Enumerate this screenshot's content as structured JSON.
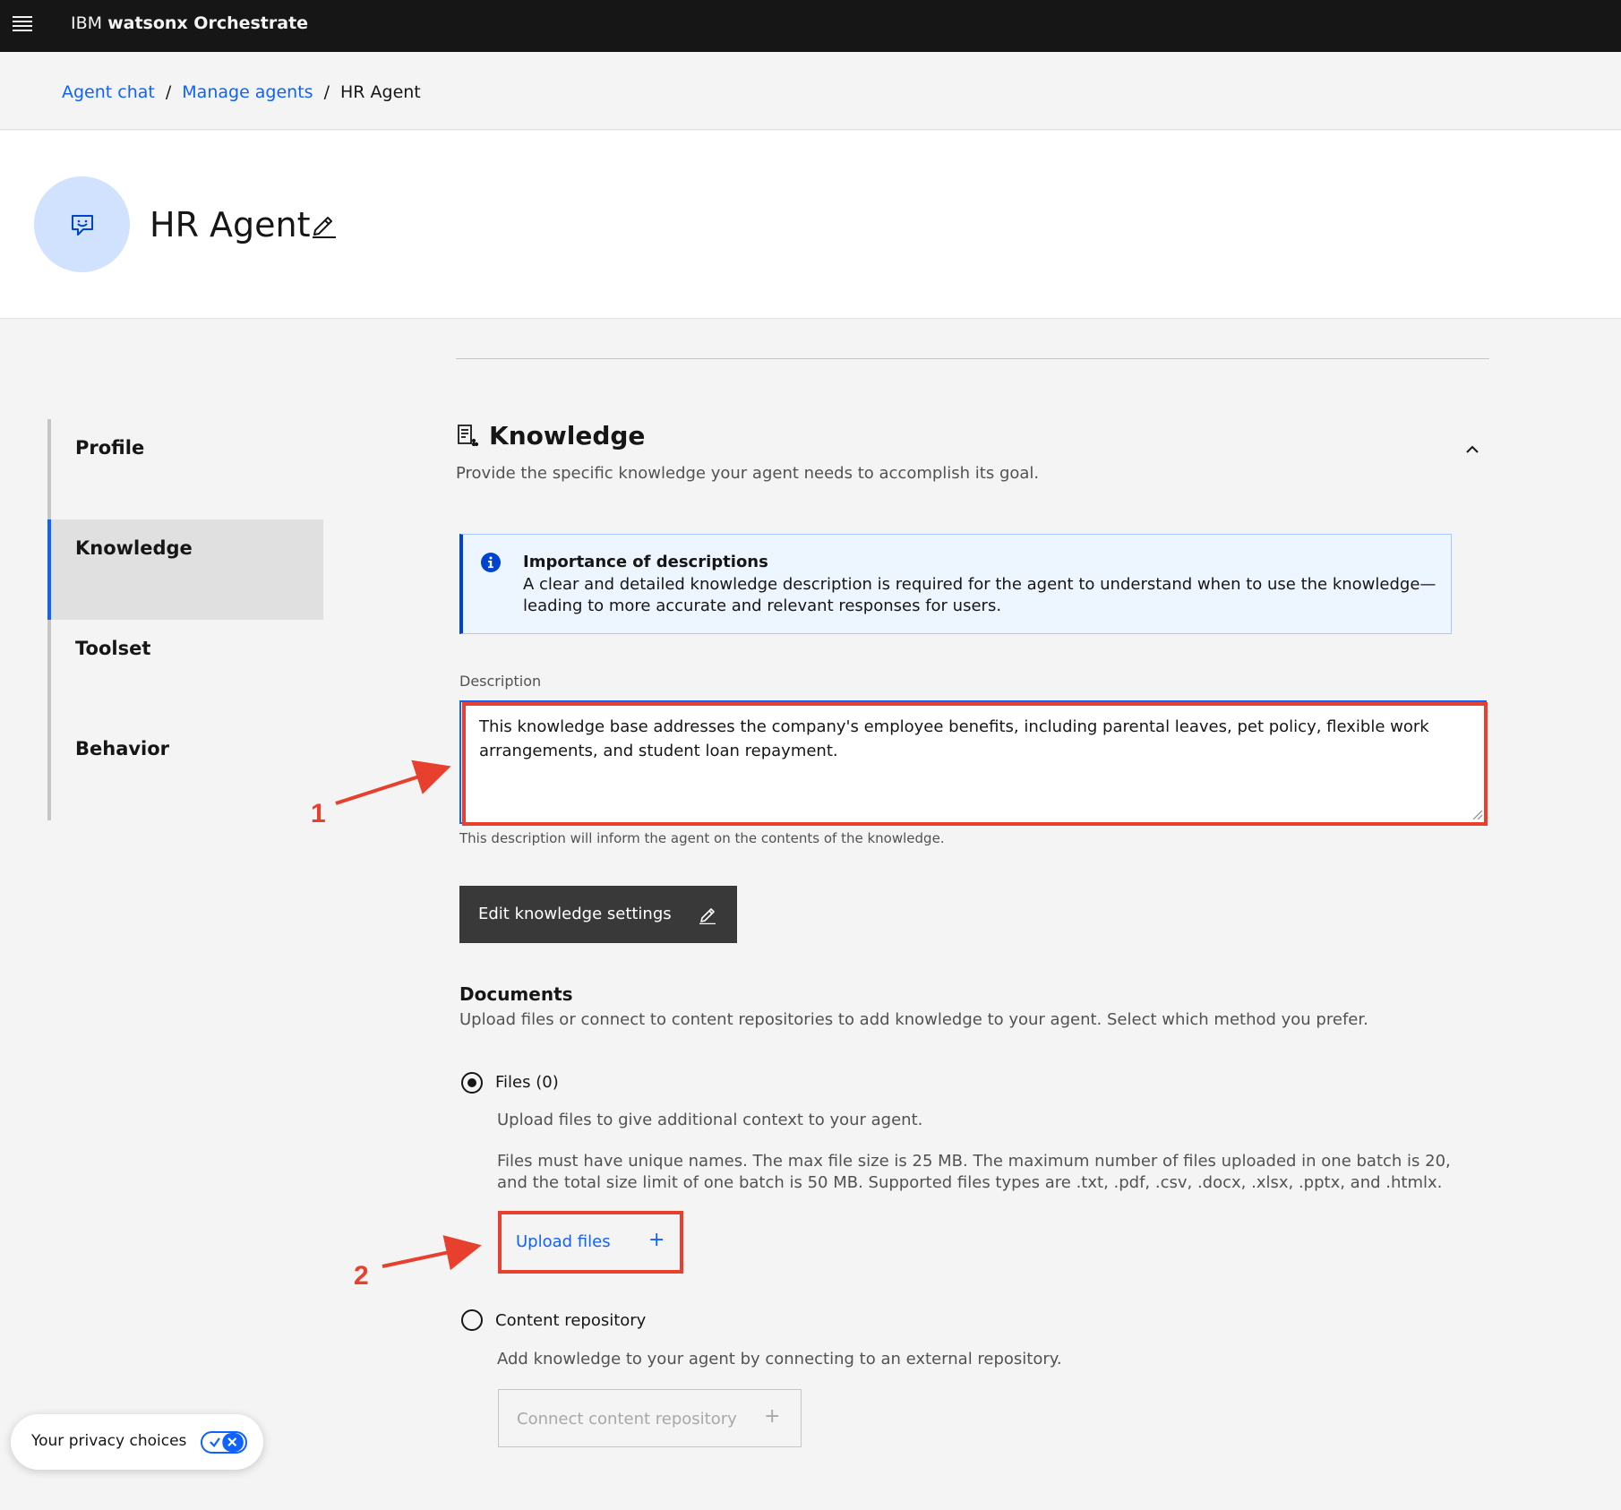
{
  "topbar": {
    "brand_prefix": "IBM ",
    "brand_name": "watsonx Orchestrate"
  },
  "breadcrumb": {
    "items": [
      {
        "label": "Agent chat"
      },
      {
        "label": "Manage agents"
      },
      {
        "label": "HR Agent"
      }
    ],
    "separator": "/"
  },
  "header": {
    "title": "HR Agent"
  },
  "sidenav": {
    "items": [
      {
        "label": "Profile"
      },
      {
        "label": "Knowledge"
      },
      {
        "label": "Toolset"
      },
      {
        "label": "Behavior"
      }
    ],
    "active": "Knowledge"
  },
  "knowledge": {
    "title": "Knowledge",
    "description": "Provide the specific knowledge your agent needs to accomplish its goal.",
    "notification": {
      "title": "Importance of descriptions",
      "body": "A clear and detailed knowledge description is required for the agent to understand when to use the knowledge—leading to more accurate and relevant responses for users."
    },
    "description_field": {
      "label": "Description",
      "value": "This knowledge base addresses the company's employee benefits, including parental leaves, pet policy, flexible work arrangements, and student loan repayment.",
      "helper": "This description will inform the agent on the contents of the knowledge."
    },
    "edit_settings_label": "Edit knowledge settings",
    "documents": {
      "title": "Documents",
      "description": "Upload files or connect to content repositories to add knowledge to your agent. Select which method you prefer.",
      "files_option": {
        "label": "Files (0)",
        "selected": true,
        "description": "Upload files to give additional context to your agent.",
        "rules": "Files must have unique names. The max file size is 25 MB. The maximum number of files uploaded in one batch is 20, and the total size limit of one batch is 50 MB. Supported files types are .txt, .pdf, .csv, .docx, .xlsx, .pptx, and .htmlx.",
        "upload_label": "Upload files",
        "upload_icon": "+"
      },
      "repo_option": {
        "label": "Content repository",
        "selected": false,
        "description": "Add knowledge to your agent by connecting to an external repository.",
        "connect_label": "Connect content repository",
        "connect_icon": "+"
      }
    }
  },
  "annotations": {
    "step1": "1",
    "step2": "2",
    "color": "#e8402e"
  },
  "privacy": {
    "label": "Your privacy choices"
  },
  "colors": {
    "accent": "#0f62fe",
    "topbar": "#161616",
    "info_bg": "#edf5ff",
    "annotation": "#e8402e"
  }
}
